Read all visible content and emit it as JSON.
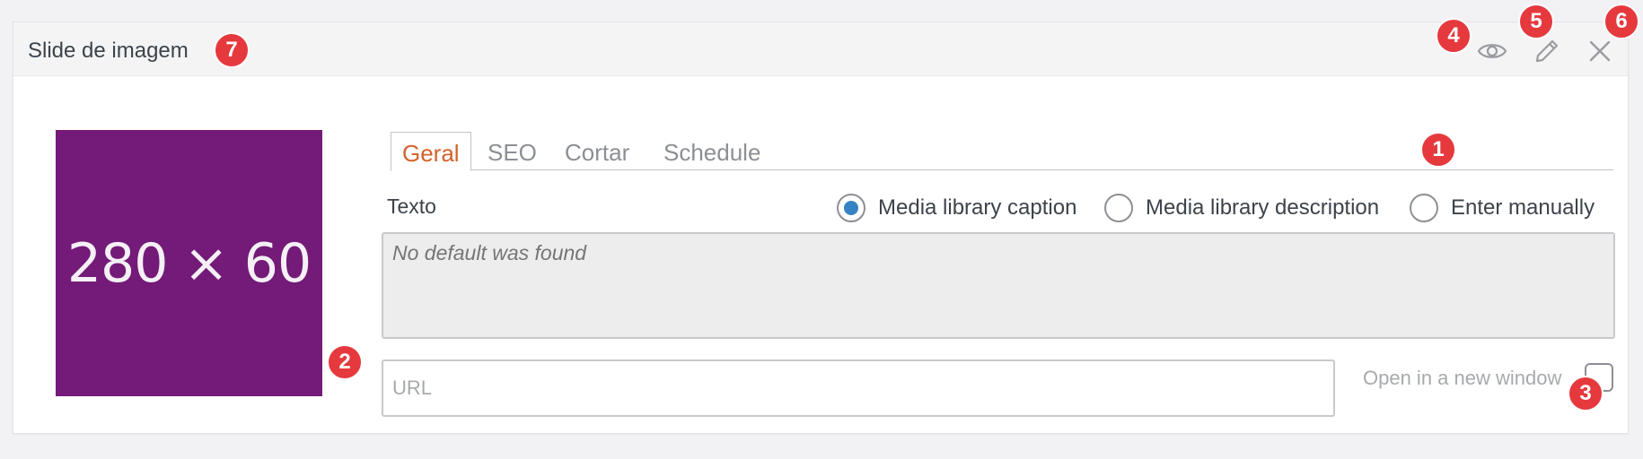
{
  "panel": {
    "title": "Slide de imagem",
    "icons": [
      "eye-icon",
      "pencil-icon",
      "close-icon"
    ]
  },
  "thumbnail": {
    "text": "280 × 60",
    "background": "#741a78"
  },
  "tabs": [
    {
      "label": "Geral",
      "active": true
    },
    {
      "label": "SEO",
      "active": false
    },
    {
      "label": "Cortar",
      "active": false
    },
    {
      "label": "Schedule",
      "active": false
    }
  ],
  "text_field": {
    "label": "Texto",
    "options": [
      {
        "label": "Media library caption",
        "checked": true
      },
      {
        "label": "Media library description",
        "checked": false
      },
      {
        "label": "Enter manually",
        "checked": false
      }
    ],
    "placeholder": "No default was found"
  },
  "url_field": {
    "placeholder": "URL",
    "value": ""
  },
  "new_window": {
    "label": "Open in a new window",
    "checked": false
  },
  "badges": [
    "1",
    "2",
    "3",
    "4",
    "5",
    "6",
    "7"
  ],
  "colors": {
    "accent_tab": "#d3622a",
    "radio_selected": "#3582c4",
    "badge": "#e5393e"
  }
}
